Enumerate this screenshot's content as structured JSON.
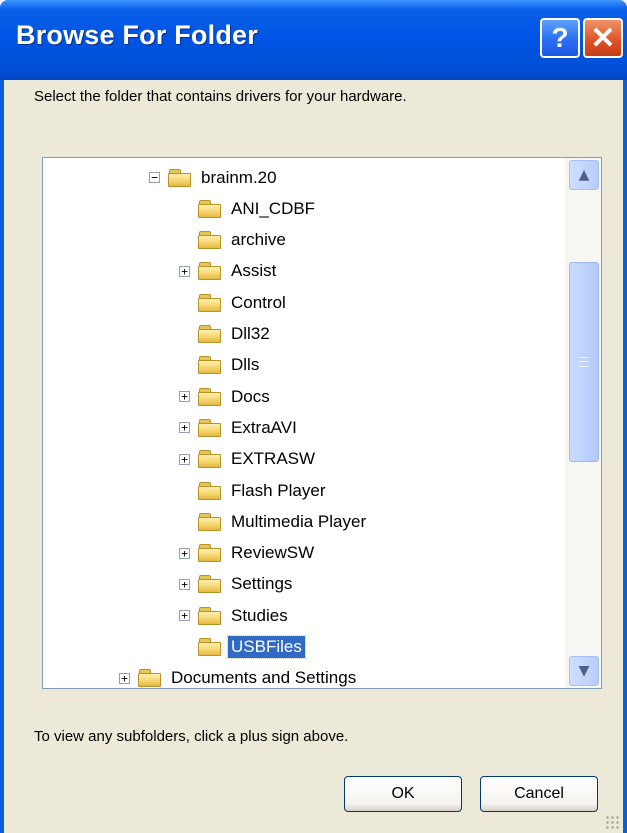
{
  "window": {
    "title": "Browse For Folder",
    "help_label": "?",
    "close_label": "✕"
  },
  "instruction": "Select the folder that contains drivers for your hardware.",
  "tree": {
    "items": [
      {
        "label": "brainm.20",
        "expander": "⊟",
        "selected": false
      },
      {
        "label": "ANI_CDBF",
        "expander": "",
        "selected": false
      },
      {
        "label": "archive",
        "expander": "",
        "selected": false
      },
      {
        "label": "Assist",
        "expander": "⊞",
        "selected": false
      },
      {
        "label": "Control",
        "expander": "",
        "selected": false
      },
      {
        "label": "Dll32",
        "expander": "",
        "selected": false
      },
      {
        "label": "Dlls",
        "expander": "",
        "selected": false
      },
      {
        "label": "Docs",
        "expander": "⊞",
        "selected": false
      },
      {
        "label": "ExtraAVI",
        "expander": "⊞",
        "selected": false
      },
      {
        "label": "EXTRASW",
        "expander": "⊞",
        "selected": false
      },
      {
        "label": "Flash Player",
        "expander": "",
        "selected": false
      },
      {
        "label": "Multimedia Player",
        "expander": "",
        "selected": false
      },
      {
        "label": "ReviewSW",
        "expander": "⊞",
        "selected": false
      },
      {
        "label": "Settings",
        "expander": "⊞",
        "selected": false
      },
      {
        "label": "Studies",
        "expander": "⊞",
        "selected": false
      },
      {
        "label": "USBFiles",
        "expander": "",
        "selected": true
      },
      {
        "label": "Documents and Settings",
        "expander": "⊞",
        "selected": false
      }
    ],
    "scroll_up_icon": "▲",
    "scroll_down_icon": "▼"
  },
  "hint": "To view any subfolders, click a plus sign above.",
  "buttons": {
    "ok_label": "OK",
    "cancel_label": "Cancel"
  },
  "colors": {
    "titlebar": "#0055e5",
    "selection": "#316ac5",
    "dialog_bg": "#ece9d8"
  }
}
